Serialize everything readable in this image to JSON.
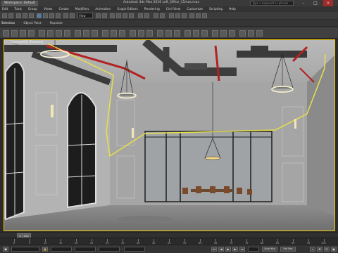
{
  "workspace": "Workspace: Default",
  "app_title": "Autodesk 3ds Max 2016    Loft_Office_15mas.max",
  "search_placeholder": "Type a keyword or phrase",
  "menus": [
    "Edit",
    "Tools",
    "Group",
    "Views",
    "Create",
    "Modifiers",
    "Animation",
    "Graph Editors",
    "Rendering",
    "Civil View",
    "Customize",
    "Scripting",
    "Help"
  ],
  "selection_filter": "View",
  "ribbon_tabs": [
    "Selection",
    "Object Paint",
    "Populate"
  ],
  "viewport_label": "[+] [Camera001] [Realistic]",
  "time_slider": "0 / 100",
  "timeline_ticks": [
    "0",
    "5",
    "10",
    "15",
    "20",
    "25",
    "30",
    "35",
    "40",
    "45",
    "50",
    "55",
    "60",
    "65",
    "70",
    "75",
    "80",
    "85",
    "90",
    "95",
    "100"
  ],
  "icons": {
    "minimize": "minimize-icon",
    "maximize": "maximize-icon",
    "close": "close-icon"
  },
  "colors": {
    "selection_outline": "#f2c700",
    "highlight_curve": "#e8e04a",
    "pipe_red": "#b22222",
    "pipe_dark": "#3a3a3a"
  },
  "status": {
    "auto_key": "Auto Key",
    "set_key": "Set Key"
  }
}
